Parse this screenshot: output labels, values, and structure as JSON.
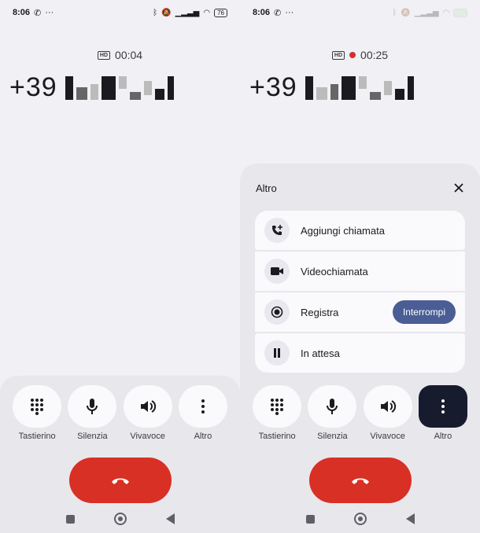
{
  "left": {
    "status": {
      "time": "8:06",
      "battery": "76"
    },
    "call": {
      "timer": "00:04",
      "hd_badge": "HD",
      "number_prefix": "+39"
    },
    "controls": [
      {
        "label": "Tastierino",
        "icon": "keypad-icon"
      },
      {
        "label": "Silenzia",
        "icon": "mic-icon"
      },
      {
        "label": "Vivavoce",
        "icon": "speaker-icon"
      },
      {
        "label": "Altro",
        "icon": "more-icon"
      }
    ]
  },
  "right": {
    "status": {
      "time": "8:06"
    },
    "call": {
      "timer": "00:25",
      "hd_badge": "HD",
      "number_prefix": "+39",
      "recording": true
    },
    "sheet": {
      "title": "Altro",
      "items": [
        {
          "label": "Aggiungi chiamata",
          "icon": "add-call-icon"
        },
        {
          "label": "Videochiamata",
          "icon": "video-icon"
        },
        {
          "label": "Registra",
          "icon": "record-icon",
          "action": "Interrompi"
        },
        {
          "label": "In attesa",
          "icon": "pause-icon"
        }
      ]
    },
    "controls": [
      {
        "label": "Tastierino",
        "icon": "keypad-icon"
      },
      {
        "label": "Silenzia",
        "icon": "mic-icon"
      },
      {
        "label": "Vivavoce",
        "icon": "speaker-icon"
      },
      {
        "label": "Altro",
        "icon": "more-icon",
        "active": true
      }
    ]
  },
  "colors": {
    "hangup": "#d93025",
    "accent": "#4a5d94",
    "active_button": "#161b2e",
    "record_dot": "#d32f2f"
  }
}
